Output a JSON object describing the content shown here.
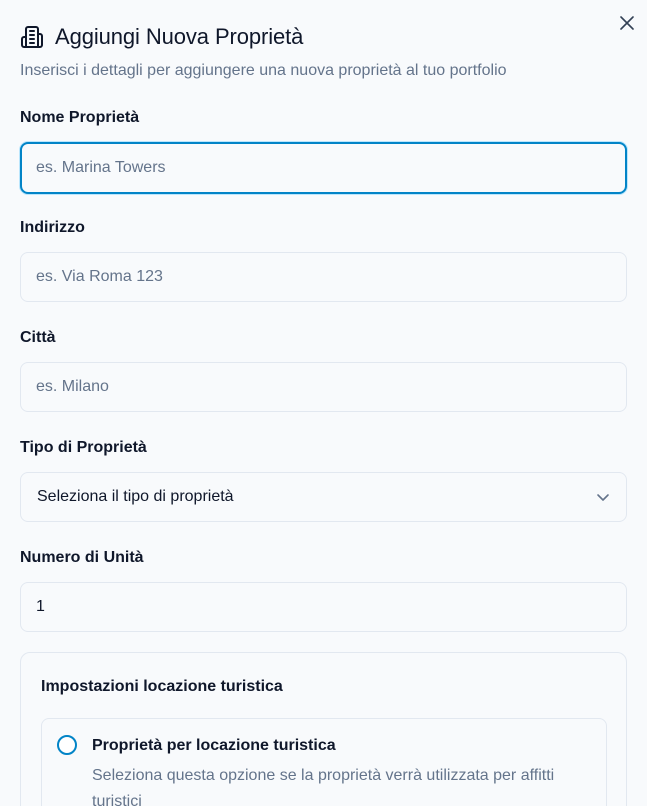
{
  "dialog": {
    "title": "Aggiungi Nuova Proprietà",
    "subtitle": "Inserisci i dettagli per aggiungere una nuova proprietà al tuo portfolio",
    "title_icon": "building-icon",
    "close_icon": "close-icon"
  },
  "fields": {
    "name": {
      "label": "Nome Proprietà",
      "placeholder": "es. Marina Towers",
      "value": ""
    },
    "address": {
      "label": "Indirizzo",
      "placeholder": "es. Via Roma 123",
      "value": ""
    },
    "city": {
      "label": "Città",
      "placeholder": "es. Milano",
      "value": ""
    },
    "type": {
      "label": "Tipo di Proprietà",
      "selected": "Seleziona il tipo di proprietà",
      "icon": "chevron-down-icon"
    },
    "units": {
      "label": "Numero di Unità",
      "value": "1"
    }
  },
  "tourist": {
    "title": "Impostazioni locazione turistica",
    "option_label": "Proprietà per locazione turistica",
    "option_description": "Seleziona questa opzione se la proprietà verrà utilizzata per affitti turistici",
    "checked": false
  },
  "colors": {
    "accent": "#0284c7",
    "text": "#0f172a",
    "muted": "#64748b",
    "border": "#e2e8f0",
    "background": "#f8fafc"
  }
}
